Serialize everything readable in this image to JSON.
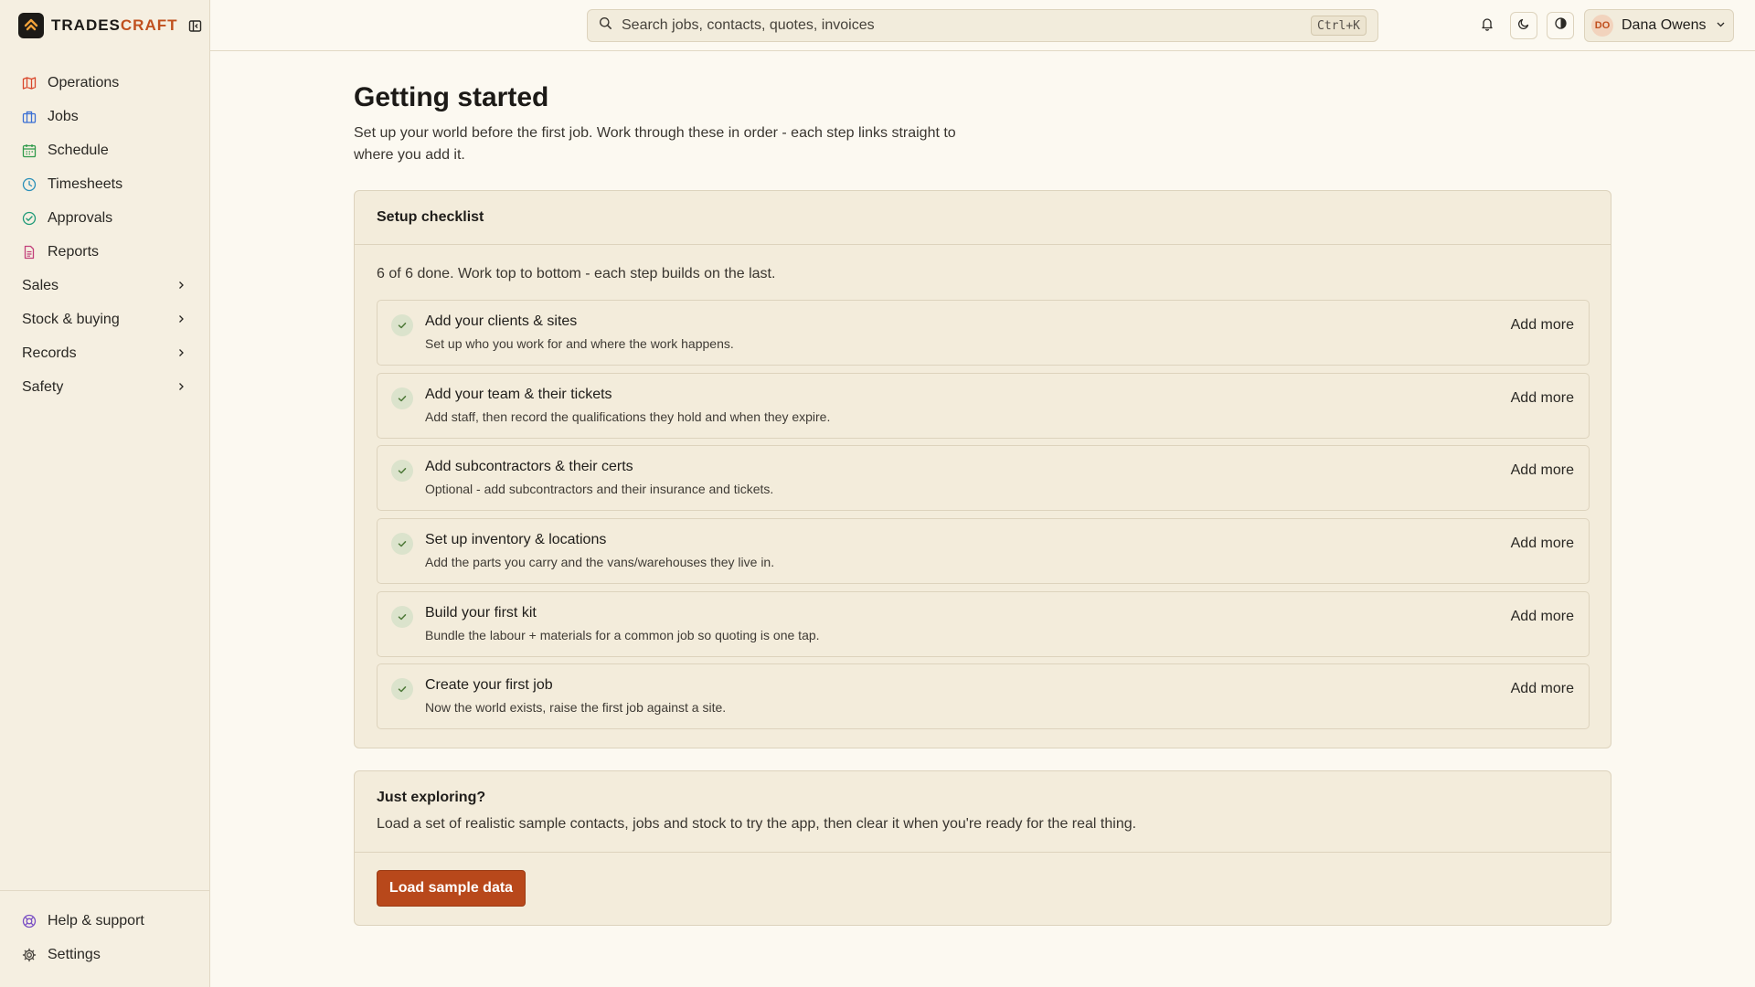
{
  "brand": {
    "name_part1": "TRADES",
    "name_part2": "CRAFT"
  },
  "search": {
    "placeholder": "Search jobs, contacts, quotes, invoices",
    "shortcut": "Ctrl+K"
  },
  "user": {
    "initials": "DO",
    "name": "Dana Owens"
  },
  "sidebar": {
    "items": [
      {
        "label": "Operations",
        "icon": "map-icon",
        "color": "#d9472b"
      },
      {
        "label": "Jobs",
        "icon": "briefcase-icon",
        "color": "#3b6fd4"
      },
      {
        "label": "Schedule",
        "icon": "calendar-icon",
        "color": "#2f9a4a"
      },
      {
        "label": "Timesheets",
        "icon": "clock-icon",
        "color": "#2a8fb8"
      },
      {
        "label": "Approvals",
        "icon": "check-circle-icon",
        "color": "#1f9a78"
      },
      {
        "label": "Reports",
        "icon": "document-icon",
        "color": "#c2407a"
      }
    ],
    "groups": [
      {
        "label": "Sales"
      },
      {
        "label": "Stock & buying"
      },
      {
        "label": "Records"
      },
      {
        "label": "Safety"
      }
    ],
    "footer": [
      {
        "label": "Help & support",
        "icon": "lifebuoy-icon",
        "color": "#7a4fc4"
      },
      {
        "label": "Settings",
        "icon": "gear-icon",
        "color": "#4a4640"
      }
    ]
  },
  "page": {
    "title": "Getting started",
    "subtitle": "Set up your world before the first job. Work through these in order - each step links straight to where you add it."
  },
  "checklist": {
    "title": "Setup checklist",
    "progress": "6 of 6 done. Work top to bottom - each step builds on the last.",
    "steps": [
      {
        "title": "Add your clients & sites",
        "desc": "Set up who you work for and where the work happens.",
        "action": "Add more"
      },
      {
        "title": "Add your team & their tickets",
        "desc": "Add staff, then record the qualifications they hold and when they expire.",
        "action": "Add more"
      },
      {
        "title": "Add subcontractors & their certs",
        "desc": "Optional - add subcontractors and their insurance and tickets.",
        "action": "Add more"
      },
      {
        "title": "Set up inventory & locations",
        "desc": "Add the parts you carry and the vans/warehouses they live in.",
        "action": "Add more"
      },
      {
        "title": "Build your first kit",
        "desc": "Bundle the labour + materials for a common job so quoting is one tap.",
        "action": "Add more"
      },
      {
        "title": "Create your first job",
        "desc": "Now the world exists, raise the first job against a site.",
        "action": "Add more"
      }
    ]
  },
  "explore": {
    "title": "Just exploring?",
    "desc": "Load a set of realistic sample contacts, jobs and stock to try the app, then clear it when you're ready for the real thing.",
    "button": "Load sample data"
  },
  "colors": {
    "accent": "#b8481b",
    "check": "#4f7a3a"
  }
}
